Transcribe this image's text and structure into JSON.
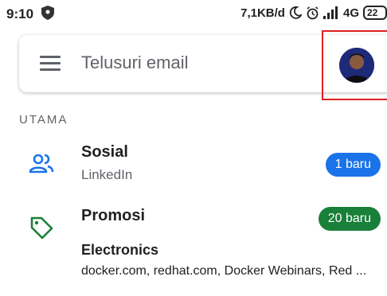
{
  "status_bar": {
    "time": "9:10",
    "speed": "7,1KB/d",
    "network": "4G",
    "battery": "22",
    "icons": [
      "shield-icon",
      "moon-icon",
      "alarm-icon",
      "signal-icon",
      "battery-icon"
    ]
  },
  "search": {
    "placeholder": "Telusuri email"
  },
  "section": {
    "label": "UTAMA"
  },
  "categories": [
    {
      "icon": "people-icon",
      "title": "Sosial",
      "subtitle": "LinkedIn",
      "badge": "1 baru",
      "badge_color": "#1a73e8"
    },
    {
      "icon": "tag-icon",
      "title": "Promosi",
      "badge": "20 baru",
      "badge_color": "#188038",
      "sender": "Electronics",
      "snippet": "docker.com, redhat.com, Docker Webinars, Red ..."
    }
  ],
  "colors": {
    "accent_blue": "#1a73e8",
    "promo_green": "#188038",
    "highlight_red": "#e02020"
  }
}
